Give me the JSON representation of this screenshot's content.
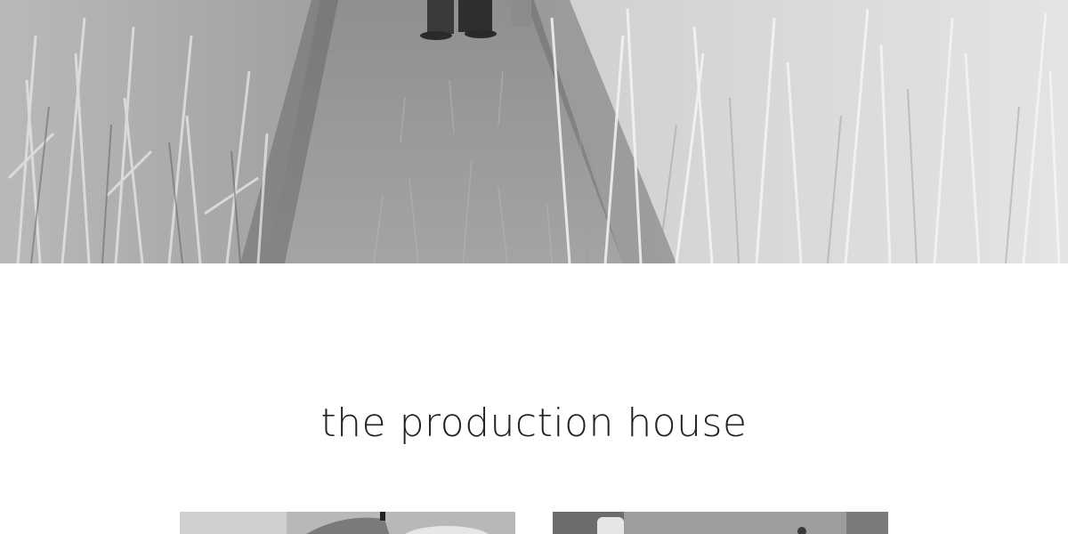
{
  "section": {
    "title": "the production house"
  },
  "hero": {
    "image": "rice-field-path-photo",
    "style": "grayscale"
  },
  "thumbnails": [
    {
      "image": "production-photo-1"
    },
    {
      "image": "production-photo-2"
    }
  ]
}
